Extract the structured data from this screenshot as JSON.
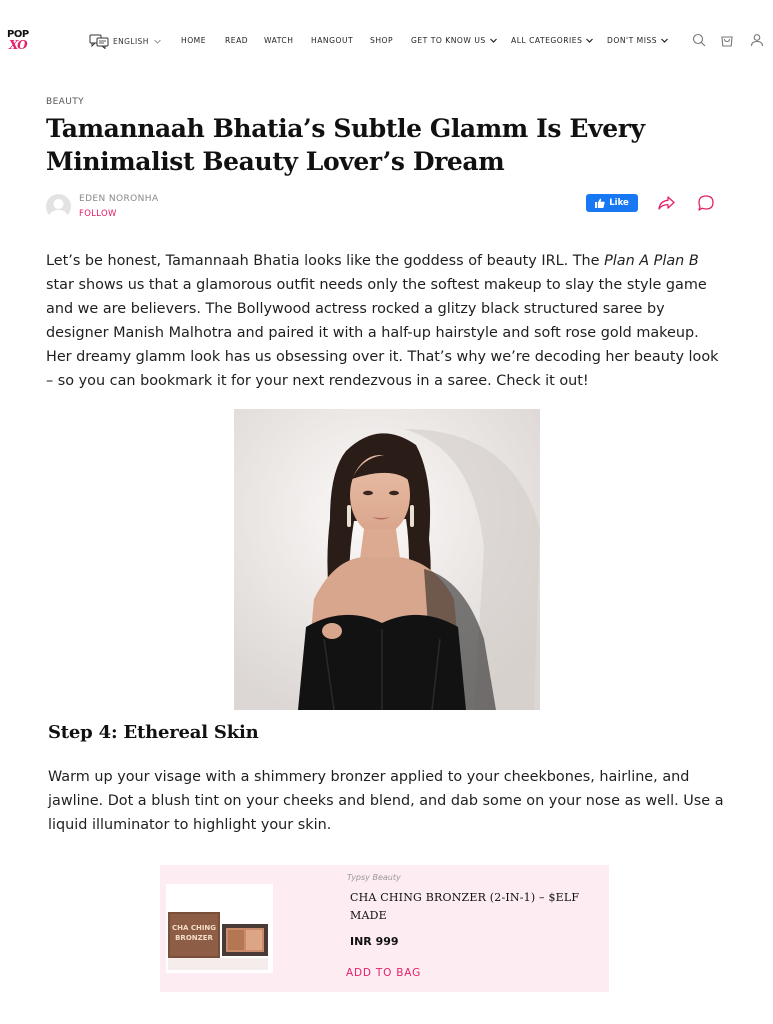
{
  "brand": {
    "logo_top": "POP",
    "logo_bottom": "XO"
  },
  "nav": {
    "language": "ENGLISH",
    "items": [
      {
        "label": "HOME"
      },
      {
        "label": "READ"
      },
      {
        "label": "WATCH"
      },
      {
        "label": "HANGOUT"
      },
      {
        "label": "SHOP"
      },
      {
        "label": "GET TO KNOW US"
      },
      {
        "label": "ALL CATEGORIES"
      },
      {
        "label": "DON'T MISS"
      }
    ]
  },
  "article": {
    "category": "BEAUTY",
    "title": "Tamannaah Bhatia’s Subtle Glamm Is Every Minimalist Beauty Lover’s Dream",
    "author": "EDEN NORONHA",
    "follow": "FOLLOW",
    "like": "Like",
    "intro": {
      "part1": "Let’s be honest, Tamannaah Bhatia looks like the goddess of beauty IRL. The ",
      "italic": "Plan A Plan B",
      "part2": " star shows us that a glamorous outfit needs only the softest makeup to slay the style game and we are believers. The Bollywood actress rocked a glitzy black structured saree by designer Manish Malhotra and paired it with a half-up hairstyle and soft rose gold makeup. Her dreamy glamm look has us obsessing over it. That’s why we’re decoding her beauty look – so you can bookmark it for your next rendezvous in a saree. Check it out!"
    },
    "step_heading": "Step 4: Ethereal Skin",
    "step_text": "Warm up your visage with a shimmery bronzer applied to your cheekbones, hairline, and jawline. Dot a blush tint on your cheeks and blend, and dab some on your nose as well. Use a liquid illuminator to highlight your skin."
  },
  "product": {
    "brand": "Typsy Beauty",
    "name": "CHA CHING BRONZER (2-IN-1) – $ELF MADE",
    "price": "INR 999",
    "cta": "ADD TO BAG"
  },
  "colors": {
    "accent": "#e5206b",
    "facebook": "#1877f2",
    "product_bg": "#fdecf1"
  }
}
